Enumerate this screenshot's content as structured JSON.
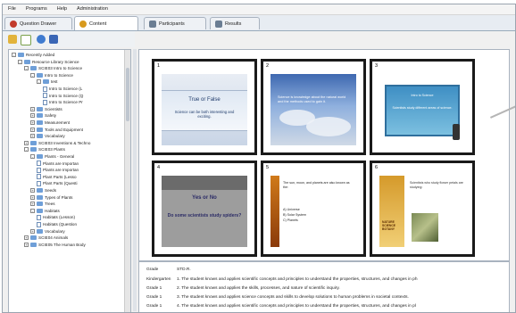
{
  "menu": [
    "File",
    "Programs",
    "Help",
    "Administration"
  ],
  "tabs": [
    {
      "label": "Question Drawer",
      "icon": "question-drawer-icon",
      "color": "#c23b2b"
    },
    {
      "label": "Content",
      "icon": "content-icon",
      "color": "#d89a1e",
      "active": true
    },
    {
      "label": "Participants",
      "icon": "participants-icon",
      "color": "#6a7d93"
    },
    {
      "label": "Results",
      "icon": "results-icon",
      "color": "#6a7d93"
    }
  ],
  "toolbar": [
    "open-folder-icon",
    "new-document-icon",
    "browse-icon",
    "view-icon"
  ],
  "tree": [
    {
      "label": "Recently Added",
      "indent": 0,
      "kind": "folder",
      "expander": "-"
    },
    {
      "label": "Resource Library Science",
      "indent": 1,
      "kind": "folder",
      "expander": "-"
    },
    {
      "label": "SCIE03 Intro to Science",
      "indent": 2,
      "kind": "folder",
      "expander": "-"
    },
    {
      "label": "Intro to Science",
      "indent": 3,
      "kind": "folder",
      "expander": "-"
    },
    {
      "label": "test",
      "indent": 4,
      "kind": "folder",
      "expander": "-"
    },
    {
      "label": "Intro to Science (L",
      "indent": 5,
      "kind": "doc"
    },
    {
      "label": "Intro to Science (Q",
      "indent": 5,
      "kind": "doc"
    },
    {
      "label": "Intro to Science Pr",
      "indent": 5,
      "kind": "doc"
    },
    {
      "label": "Scientists",
      "indent": 3,
      "kind": "folder",
      "expander": "+"
    },
    {
      "label": "Safety",
      "indent": 3,
      "kind": "folder",
      "expander": "+"
    },
    {
      "label": "Measurement",
      "indent": 3,
      "kind": "folder",
      "expander": "+"
    },
    {
      "label": "Tools and Equipment",
      "indent": 3,
      "kind": "folder",
      "expander": "+"
    },
    {
      "label": "Vocabulary",
      "indent": 3,
      "kind": "folder",
      "expander": "+"
    },
    {
      "label": "SCIE03 Inventions & Techno",
      "indent": 2,
      "kind": "folder",
      "expander": "+"
    },
    {
      "label": "SCIE03 Plants",
      "indent": 2,
      "kind": "folder",
      "expander": "-"
    },
    {
      "label": "Plants - General",
      "indent": 3,
      "kind": "folder",
      "expander": "-"
    },
    {
      "label": "Plants are Importan",
      "indent": 4,
      "kind": "doc"
    },
    {
      "label": "Plants are Importan",
      "indent": 4,
      "kind": "doc"
    },
    {
      "label": "Plant Parts (Lesso",
      "indent": 4,
      "kind": "doc"
    },
    {
      "label": "Plant Parts (Questi",
      "indent": 4,
      "kind": "doc"
    },
    {
      "label": "Seeds",
      "indent": 3,
      "kind": "folder",
      "expander": "+"
    },
    {
      "label": "Types of Plants",
      "indent": 3,
      "kind": "folder",
      "expander": "+"
    },
    {
      "label": "Trees",
      "indent": 3,
      "kind": "folder",
      "expander": "+"
    },
    {
      "label": "Habitats",
      "indent": 3,
      "kind": "folder",
      "expander": "-"
    },
    {
      "label": "Habitats (Lesson)",
      "indent": 4,
      "kind": "doc"
    },
    {
      "label": "Habitats (Question",
      "indent": 4,
      "kind": "doc"
    },
    {
      "label": "Vocabulary",
      "indent": 3,
      "kind": "folder",
      "expander": "+"
    },
    {
      "label": "SCIE04 Animals",
      "indent": 2,
      "kind": "folder",
      "expander": "+"
    },
    {
      "label": "SCIE05 The Human Body",
      "indent": 2,
      "kind": "folder",
      "expander": "+"
    }
  ],
  "slides": [
    {
      "num": "1",
      "title": "True or False",
      "body": "Science can be both interesting and exciting."
    },
    {
      "num": "2",
      "text": "Science is knowledge about the natural world and the methods used to gain it."
    },
    {
      "num": "3",
      "title": "Intro to Science",
      "body": "Scientists study different areas of science."
    },
    {
      "num": "4",
      "title": "Yes or No",
      "body": "Do some scientists study spiders?"
    },
    {
      "num": "5",
      "text": "The sun, moon, and planets are also known as the:",
      "options": [
        "A) Universe",
        "B) Solar System",
        "C) Planets"
      ]
    },
    {
      "num": "6",
      "text": "Scientists who study flower petals are studying:",
      "caption": "NATURE SCIENCE BOTANY"
    }
  ],
  "standards": {
    "header": {
      "grade": "Grade",
      "std": "STD.R."
    },
    "rows": [
      {
        "grade": "Kindergarten",
        "text": "1. The student knows and applies scientific concepts and principles to understand the properties, structures, and changes in ph"
      },
      {
        "grade": "Grade 1",
        "text": "2. The student knows and applies the skills, processes, and nature of scientific inquiry."
      },
      {
        "grade": "Grade 1",
        "text": "3. The student knows and applies science concepts and skills to develop solutions to human problems in societal contexts."
      },
      {
        "grade": "Grade 1",
        "text": "4. The student knows and applies scientific concepts and principles to understand the properties, structures, and changes in pl"
      }
    ]
  }
}
